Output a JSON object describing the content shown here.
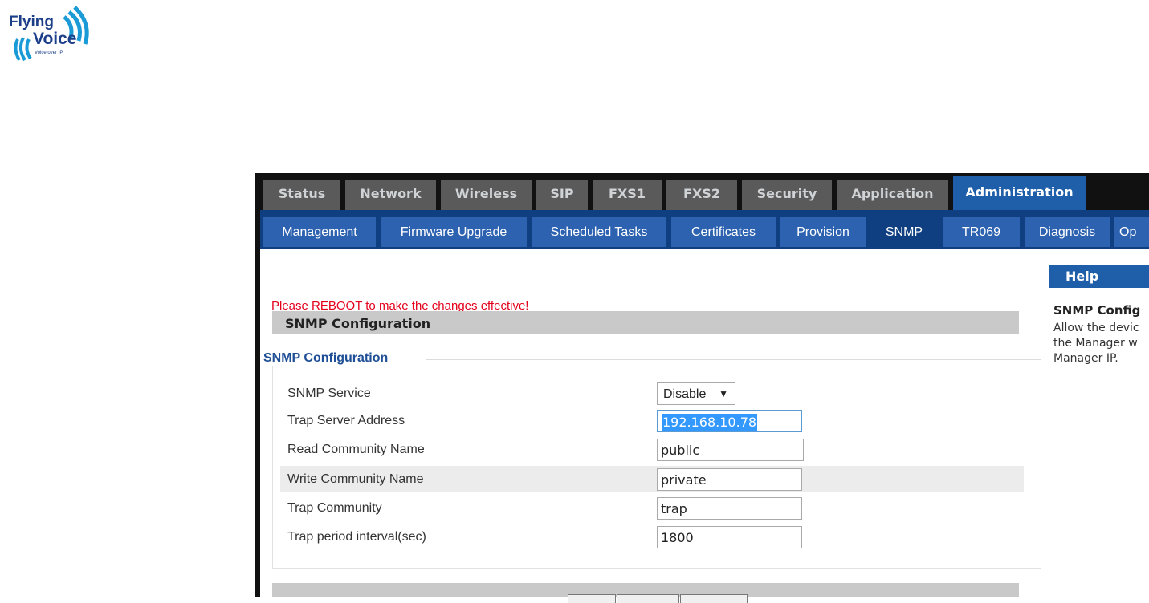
{
  "logo": {
    "line1": "Flying",
    "line2": "Voice",
    "tagline": "Voice over IP"
  },
  "main_tabs": [
    "Status",
    "Network",
    "Wireless",
    "SIP",
    "FXS1",
    "FXS2",
    "Security",
    "Application",
    "Administration"
  ],
  "active_main_tab": "Administration",
  "sub_tabs": [
    "Management",
    "Firmware Upgrade",
    "Scheduled Tasks",
    "Certificates",
    "Provision",
    "SNMP",
    "TR069",
    "Diagnosis",
    "Op"
  ],
  "active_sub_tab": "SNMP",
  "notice": "Please REBOOT to make the changes effective!",
  "section_header": "SNMP Configuration",
  "fieldset_legend": "SNMP Configuration",
  "fields": {
    "snmp_service": {
      "label": "SNMP Service",
      "value": "Disable"
    },
    "trap_server_address": {
      "label": "Trap Server Address",
      "value": "192.168.10.78"
    },
    "read_community_name": {
      "label": "Read Community Name",
      "value": "public"
    },
    "write_community_name": {
      "label": "Write Community Name",
      "value": "private"
    },
    "trap_community": {
      "label": "Trap Community",
      "value": "trap"
    },
    "trap_period_interval": {
      "label": "Trap period interval(sec)",
      "value": "1800"
    }
  },
  "help": {
    "header": "Help",
    "title": "SNMP Config",
    "lines": [
      "Allow the devic",
      "the Manager w",
      "Manager IP."
    ]
  },
  "colors": {
    "active_tab": "#1f5ea8",
    "notice": "#e4001b",
    "legend": "#1f4f96"
  }
}
